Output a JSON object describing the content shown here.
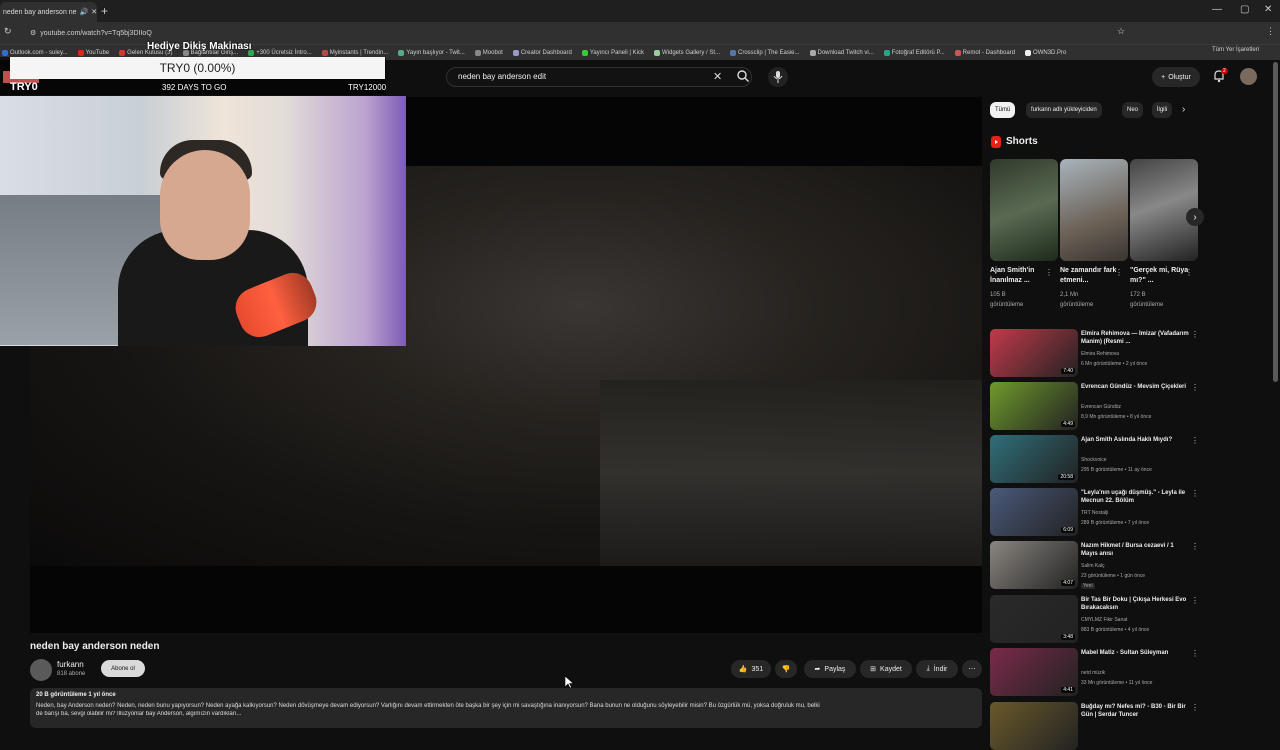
{
  "browser": {
    "tab_title": "neden bay anderson ne",
    "url": "youtube.com/watch?v=Tq5bj3DIIoQ",
    "bookmarks": [
      "Outlook.com - suley...",
      "YouTube",
      "Gelen Kutusu (3)",
      "Bağlantılar Giriş...",
      "+300 Ücretsiz İntro...",
      "Myinstants | Trendin...",
      "Yayın başlıyor - Twit...",
      "Moobot",
      "Creator Dashboard",
      "Yayıncı Paneli | Kick",
      "Widgets Gallery / St...",
      "Crossclip | The Easie...",
      "Download Twitch vi...",
      "Fotoğraf Editörü P...",
      "Remot - Dashboard",
      "OWN3D.Pro"
    ],
    "bookmarks_all": "Tüm Yer İşaretleri"
  },
  "overlay": {
    "title": "Hediye Dikiş Makinası",
    "progress_text": "TRY0 (0.00%)",
    "progress_fraction": 0.0,
    "left_label": "TRY0",
    "days_left": "392 DAYS TO GO",
    "goal": "TRY12000"
  },
  "youtube": {
    "search_query": "neden bay anderson edit",
    "create_label": "Oluştur",
    "notifications": "2"
  },
  "video": {
    "title": "neden bay anderson neden",
    "channel": "furkann",
    "subscribers": "818 abone",
    "subscribe_label": "Abone ol",
    "likes": "351",
    "share_label": "Paylaş",
    "save_label": "Kaydet",
    "download_label": "İndir",
    "views_date": "20 B görüntüleme  1 yıl önce",
    "description": "Neden, bay Anderson neden? Neden, neden bunu yapıyorsun? Neden ayağa kalkıyorsun? Neden dövüşmeye devam ediyorsun? Varlığını devam ettirmekten öte başka bir şey için mi savaştığına inanıyorsun? Bana bunun ne olduğunu söyleyebilir misin? Bu özgürlük mü, yoksa doğruluk mu, belki",
    "description_line2": "de barışı ba, sevgi olabilir mi? İllüzyonlar bay Anderson, algımızın vardıkları..."
  },
  "sidebar": {
    "chips": [
      "Tümü",
      "furkann adlı yükleyiciden",
      "Neo",
      "İlgili"
    ],
    "shorts_title": "Shorts",
    "shorts": [
      {
        "title": "Ajan Smith'in İnanılmaz ...",
        "views": "105 B",
        "views_label": "görüntüleme"
      },
      {
        "title": "Ne zamandır fark etmeni...",
        "views": "2,1 Mn",
        "views_label": "görüntüleme"
      },
      {
        "title": "\"Gerçek mi, Rüya mı?\" ...",
        "views": "172 B",
        "views_label": "görüntüleme"
      }
    ],
    "recommended": [
      {
        "title": "Elmira Rehimova — İmizar (Vafadarım Manim) (Resmi ...",
        "channel": "Elmira Rehimova",
        "meta": "6 Mn görüntüleme • 2 yıl önce",
        "duration": "7:40",
        "color": "#c23a4a"
      },
      {
        "title": "Evrencan Gündüz - Mevsim Çiçekleri",
        "channel": "Evrencan Gündüz",
        "meta": "8,9 Mn görüntüleme • 8 yıl önce",
        "duration": "4:49",
        "color": "#6f9a2c"
      },
      {
        "title": "Ajan Smith Aslında Haklı Mıydı?",
        "channel": "Shockvoice",
        "meta": "295 B görüntüleme • 11 ay önce",
        "duration": "20:58",
        "color": "#2f6f7a"
      },
      {
        "title": "\"Leyla'nın uçağı düşmüş.\" - Leyla ile Mecnun 22. Bölüm",
        "channel": "TRT Nostalji",
        "meta": "289 B görüntüleme • 7 yıl önce",
        "duration": "6:09",
        "color": "#4a5a7a"
      },
      {
        "title": "Nazım Hikmet / Bursa cezaevi / 1 Mayıs anısı",
        "channel": "Salim Kalç",
        "meta": "23 görüntüleme • 1 gün önce",
        "badge": "Yeni",
        "duration": "4:07",
        "color": "#8a8680"
      },
      {
        "title": "Bir Tas Bir Doku | Çıkışa Herkesi Evo Bırakacaksın",
        "channel": "CMYLMZ Fikir Sanat",
        "meta": "883 B görüntüleme • 4 yıl önce",
        "duration": "3:48",
        "color": "#2a2a2a"
      },
      {
        "title": "Mabel Matiz - Sultan Süleyman",
        "channel": "netd müzik",
        "meta": "33 Mn görüntüleme • 11 yıl önce",
        "duration": "4:41",
        "color": "#7a2a4a"
      },
      {
        "title": "Buğday mı? Nefes mi? - B30 - Bir Bir Gün | Serdar Tuncer",
        "channel": "",
        "meta": "",
        "duration": "",
        "color": "#6a5a2a"
      }
    ]
  },
  "colors": {
    "background": "#0f0f0f",
    "chip_active": "#f1f1f1",
    "accent_red": "#cc0000"
  }
}
